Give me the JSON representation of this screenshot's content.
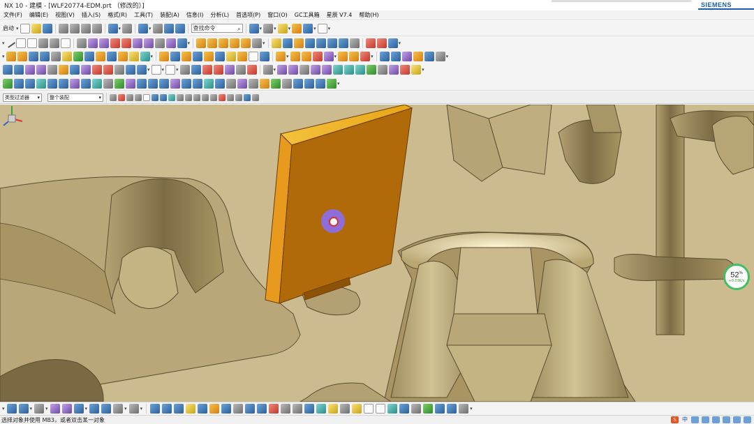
{
  "window": {
    "title": "NX 10 - 建模 - [WLF20774-EDM.prt （修改的）]",
    "brand": "SIEMENS"
  },
  "menu": {
    "items": [
      "文件(F)",
      "编辑(E)",
      "视图(V)",
      "插入(S)",
      "格式(R)",
      "工具(T)",
      "装配(A)",
      "信息(I)",
      "分析(L)",
      "首选项(P)",
      "窗口(O)",
      "GC工具箱",
      "星辰 V7.4",
      "帮助(H)"
    ]
  },
  "toolbar": {
    "start_label": "启动",
    "command_search": "查找命令"
  },
  "selection_bar": {
    "type_filter": "类型过滤器",
    "scope": "整个装配"
  },
  "viewport": {
    "model_color": "#c9b98d",
    "electrode_color": "#b06a0a",
    "cursor_accent": "#8c6ef0"
  },
  "network_widget": {
    "percent": "52",
    "percent_unit": "%",
    "rate": "+0.03K/s"
  },
  "status": {
    "message": "选择对象并使用 MB3，或者双击某一对象"
  },
  "tray": {
    "sogou": "S",
    "lang": "中"
  }
}
